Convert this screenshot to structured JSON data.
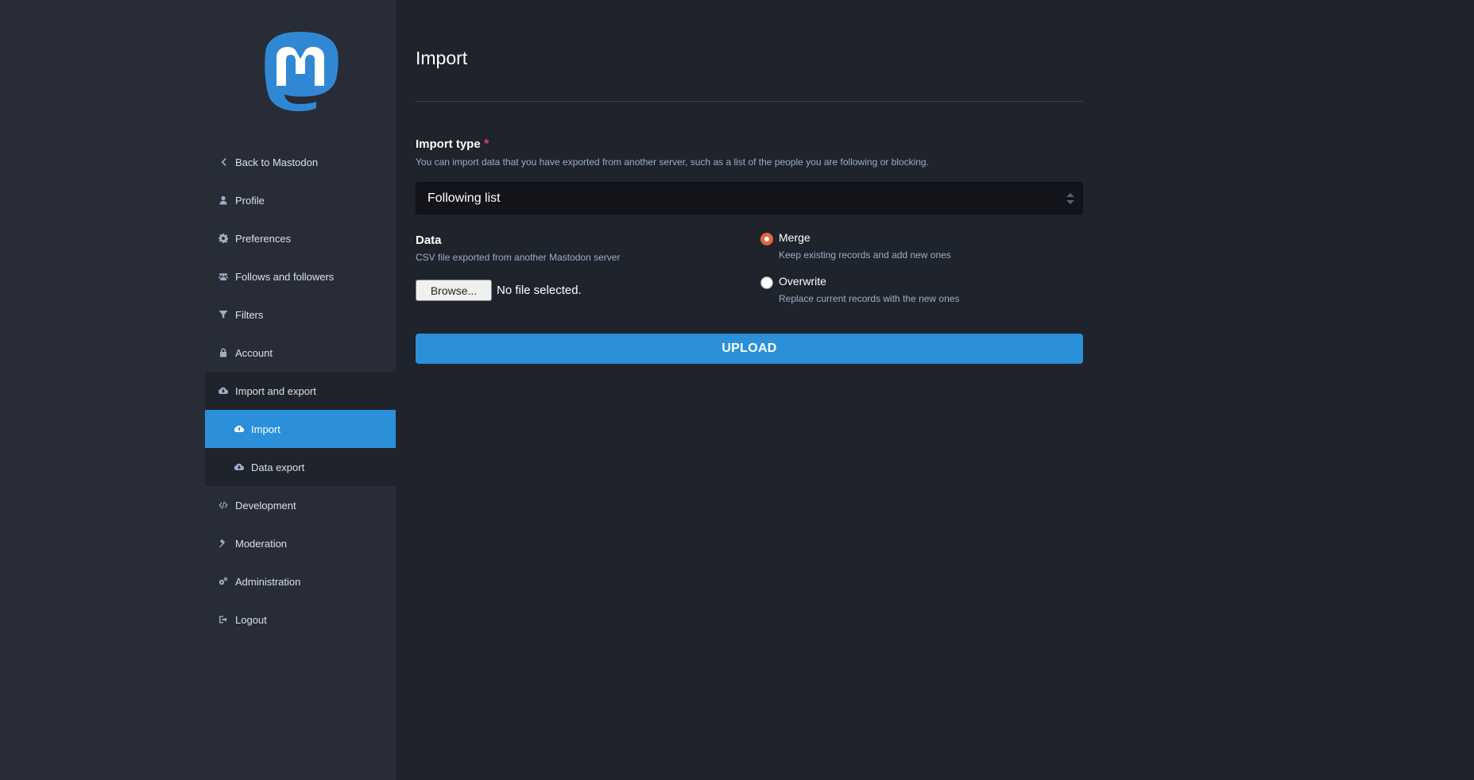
{
  "sidebar": {
    "items": [
      {
        "label": "Back to Mastodon",
        "icon": "chevron-left-icon"
      },
      {
        "label": "Profile",
        "icon": "user-icon"
      },
      {
        "label": "Preferences",
        "icon": "cog-icon"
      },
      {
        "label": "Follows and followers",
        "icon": "users-icon"
      },
      {
        "label": "Filters",
        "icon": "filter-icon"
      },
      {
        "label": "Account",
        "icon": "lock-icon"
      },
      {
        "label": "Import and export",
        "icon": "cloud-download-icon"
      },
      {
        "label": "Import",
        "icon": "cloud-upload-icon"
      },
      {
        "label": "Data export",
        "icon": "cloud-download-icon"
      },
      {
        "label": "Development",
        "icon": "code-icon"
      },
      {
        "label": "Moderation",
        "icon": "gavel-icon"
      },
      {
        "label": "Administration",
        "icon": "cogs-icon"
      },
      {
        "label": "Logout",
        "icon": "sign-out-icon"
      }
    ]
  },
  "main": {
    "title": "Import",
    "import_type": {
      "label": "Import type",
      "required_marker": "*",
      "hint": "You can import data that you have exported from another server, such as a list of the people you are following or blocking.",
      "selected": "Following list"
    },
    "data": {
      "label": "Data",
      "hint": "CSV file exported from another Mastodon server",
      "browse_label": "Browse...",
      "file_status": "No file selected."
    },
    "mode": {
      "options": [
        {
          "label": "Merge",
          "hint": "Keep existing records and add new ones",
          "checked": true
        },
        {
          "label": "Overwrite",
          "hint": "Replace current records with the new ones",
          "checked": false
        }
      ]
    },
    "upload_label": "UPLOAD"
  },
  "colors": {
    "accent": "#2b90d9",
    "radio_checked": "#e0683f",
    "required": "#df405a",
    "sidebar_bg": "#282c37",
    "page_bg": "#1f232b"
  }
}
